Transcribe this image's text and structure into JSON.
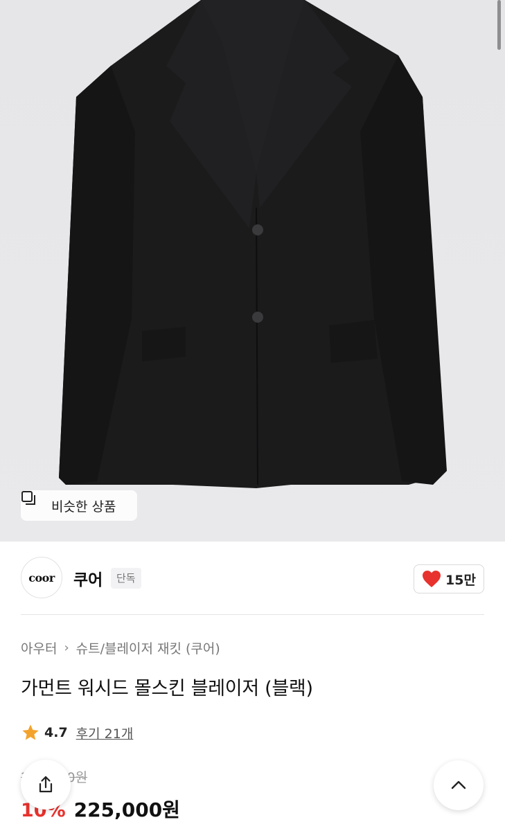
{
  "hero": {
    "similar_label": "비슷한 상품",
    "similar_icon": "similar-products-icon",
    "bg_color": "#e8e8ea"
  },
  "brand": {
    "logo_text": "coor",
    "name": "쿠어",
    "badge": "단독",
    "likes": "15만",
    "heart_color": "#e8322d"
  },
  "breadcrumb": {
    "category": "아우터",
    "subcategory": "슈트/블레이저 재킷 (쿠어)"
  },
  "product": {
    "title": "가먼트 워시드 몰스킨 블레이저 (블랙)",
    "rating": "4.7",
    "reviews": "후기 21개",
    "original_price": "250,000원",
    "discount": "10%",
    "price": "225,000원",
    "accent_color": "#e8322d",
    "star_color": "#f3a32c"
  },
  "actions": {
    "share_icon": "share-icon",
    "top_icon": "chevron-up-icon"
  }
}
